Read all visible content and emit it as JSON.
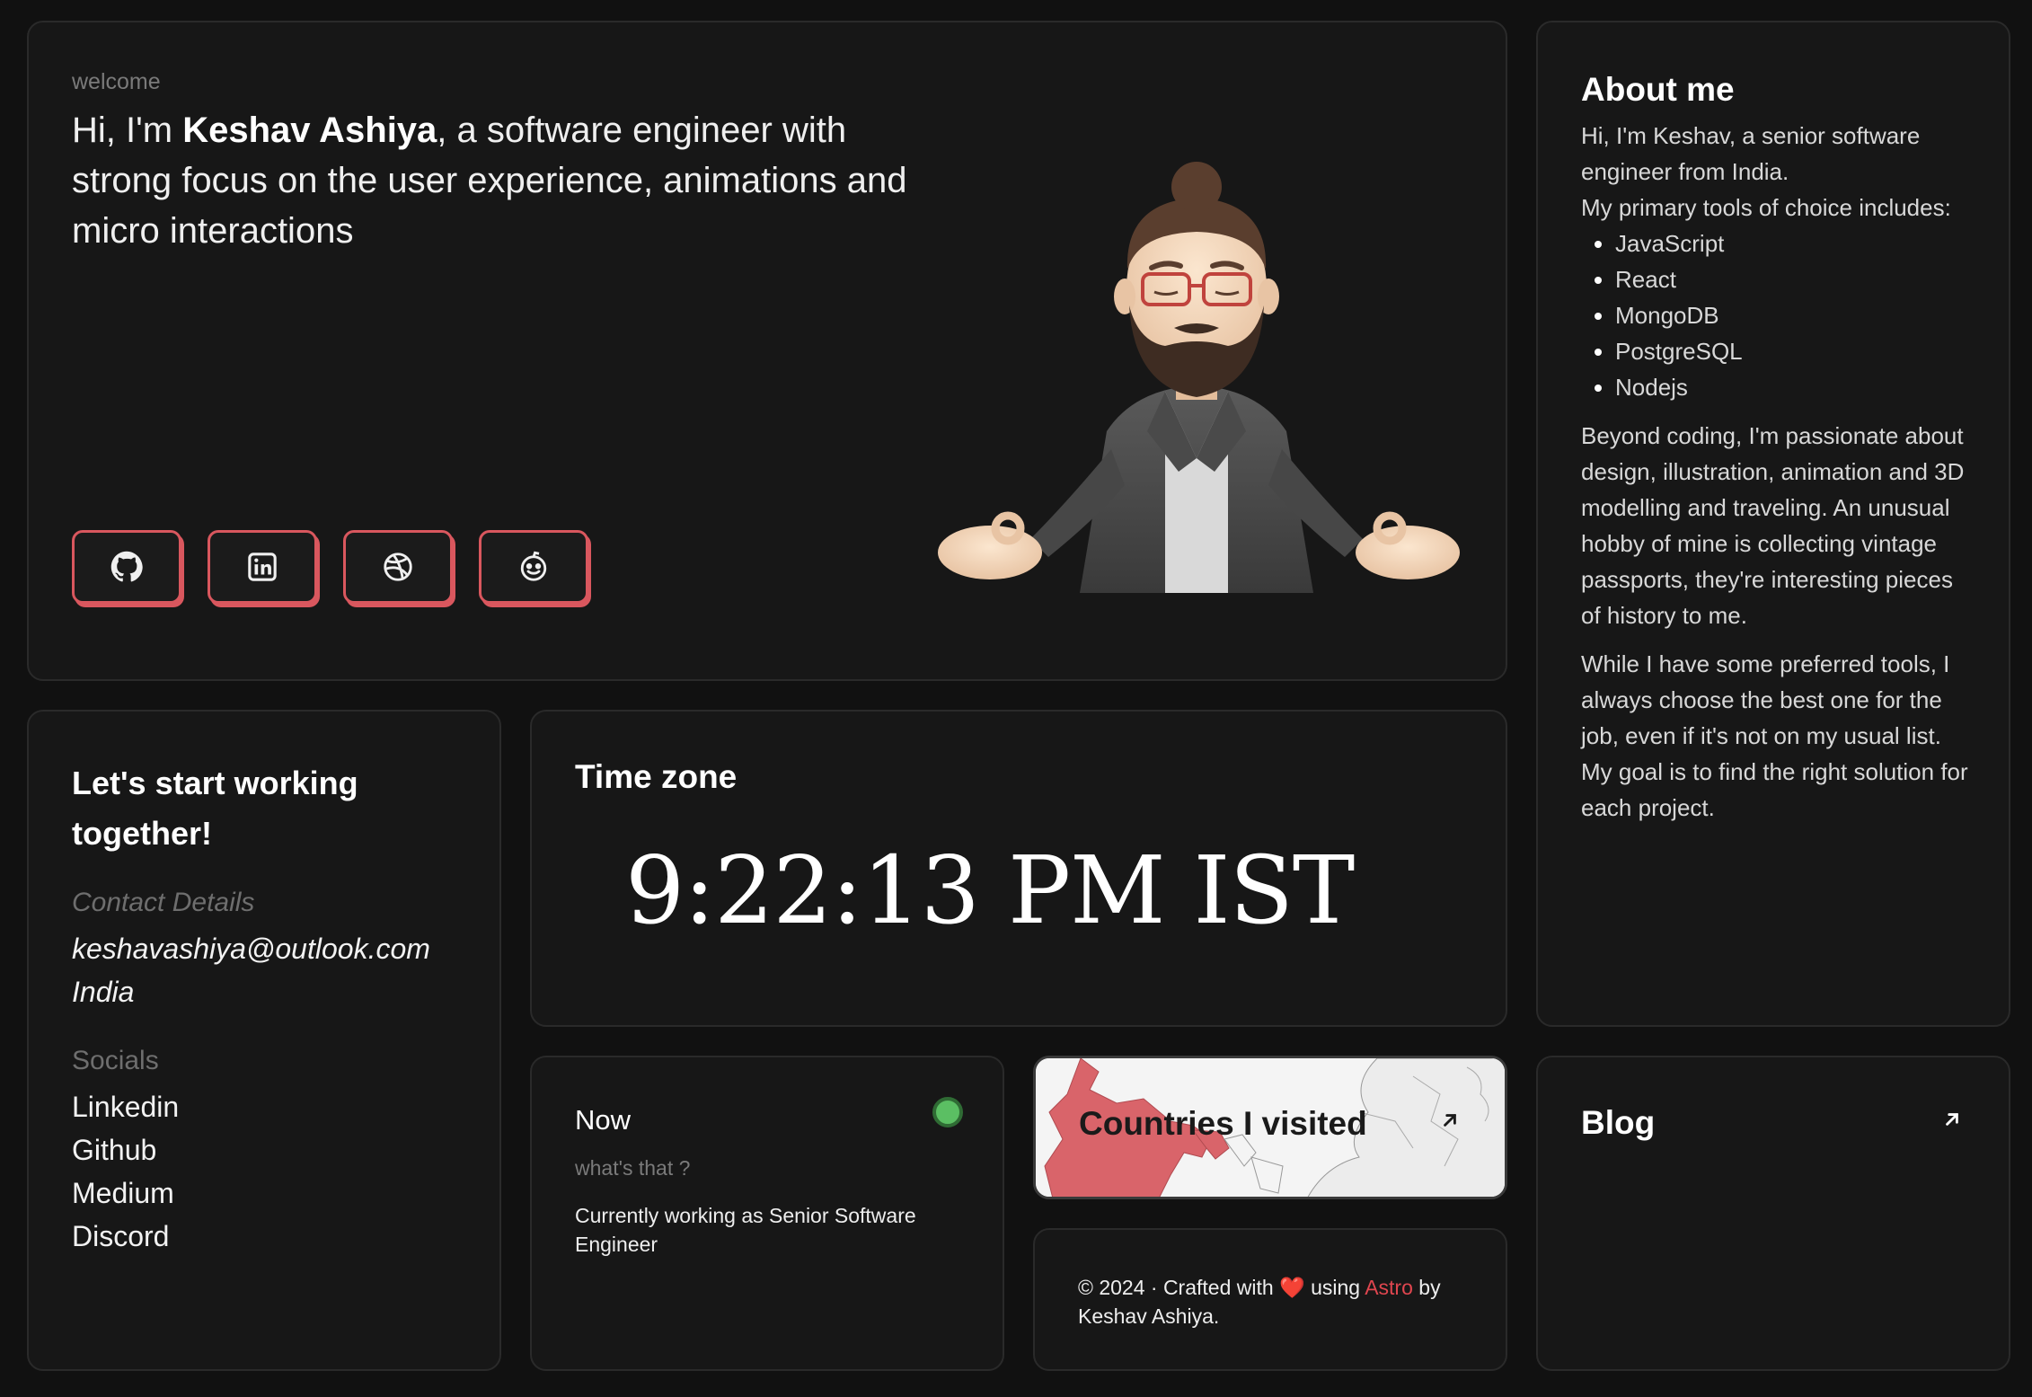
{
  "hero": {
    "welcome": "welcome",
    "intro_prefix": "Hi, I'm ",
    "name": "Keshav Ashiya",
    "intro_suffix": ", a software engineer with strong focus on the user experience, animations and micro interactions",
    "social_icons": [
      "github-icon",
      "linkedin-icon",
      "dribbble-icon",
      "reddit-icon"
    ]
  },
  "about": {
    "title": "About me",
    "p1": "Hi, I'm Keshav, a senior software engineer from India.",
    "p2": "My primary tools of choice includes:",
    "tools": [
      "JavaScript",
      "React",
      "MongoDB",
      "PostgreSQL",
      "Nodejs"
    ],
    "p3": "Beyond coding, I'm passionate about design, illustration, animation and 3D modelling and traveling. An unusual hobby of mine is collecting vintage passports, they're interesting pieces of history to me.",
    "p4": "While I have some preferred tools, I always choose the best one for the job, even if it's not on my usual list. My goal is to find the right solution for each project."
  },
  "contact": {
    "title": "Let's start working together!",
    "details_label": "Contact Details",
    "email": "keshavashiya@outlook.com",
    "location": "India",
    "socials_label": "Socials",
    "socials": [
      "Linkedin",
      "Github",
      "Medium",
      "Discord"
    ]
  },
  "timezone": {
    "title": "Time zone",
    "time": "9:22:13 PM IST"
  },
  "now": {
    "title": "Now",
    "subtitle": "what's that ?",
    "text": "Currently working as Senior Software Engineer",
    "status_color": "#5bbf63"
  },
  "countries": {
    "title": "Countries I visited",
    "highlight_color": "#d9646a"
  },
  "footer": {
    "prefix": "© 2024 · Crafted with",
    "heart": "❤️",
    "using": "using",
    "astro": "Astro",
    "suffix": "by Keshav Ashiya."
  },
  "blog": {
    "title": "Blog"
  },
  "theme": {
    "background": "#111111",
    "card": "#171717",
    "accent": "#d9575e"
  }
}
